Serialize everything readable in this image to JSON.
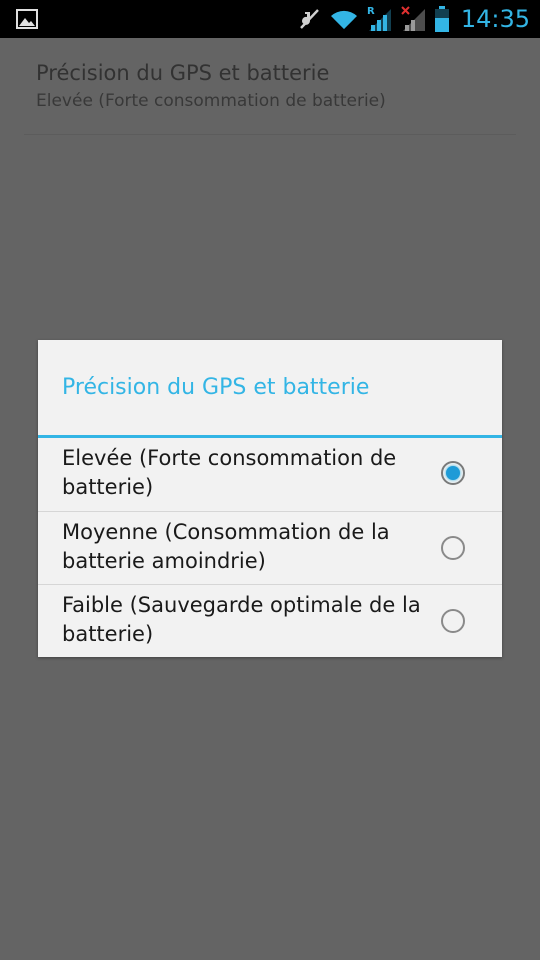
{
  "status_bar": {
    "time": "14:35",
    "icons": [
      "gallery-notification-icon",
      "mute-icon",
      "wifi-icon",
      "signal-roaming-icon",
      "signal-no-sim-icon",
      "battery-icon"
    ],
    "roaming_indicator": "R",
    "accent_color": "#33b5e5"
  },
  "background_preference": {
    "title": "Précision du GPS et batterie",
    "summary": "Elevée (Forte consommation de batterie)"
  },
  "dialog": {
    "title": "Précision du GPS et batterie",
    "accent_color": "#33b5e5",
    "options": [
      {
        "label": "Elevée (Forte consommation de batterie)",
        "selected": true
      },
      {
        "label": "Moyenne (Consommation de la batterie amoindrie)",
        "selected": false
      },
      {
        "label": "Faible (Sauvegarde optimale de la batterie)",
        "selected": false
      }
    ]
  }
}
